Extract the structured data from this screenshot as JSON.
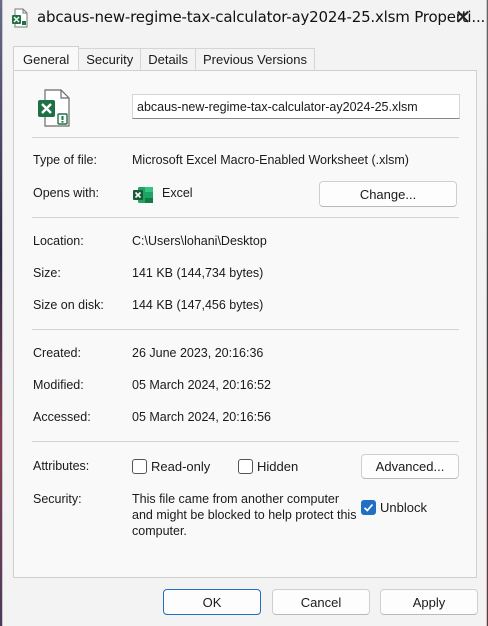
{
  "window": {
    "title": "abcaus-new-regime-tax-calculator-ay2024-25.xlsm Properti...",
    "close_label": "✕"
  },
  "tabs": [
    {
      "label": "General"
    },
    {
      "label": "Security"
    },
    {
      "label": "Details"
    },
    {
      "label": "Previous Versions"
    }
  ],
  "file": {
    "name": "abcaus-new-regime-tax-calculator-ay2024-25.xlsm",
    "icon": "excel-file-icon"
  },
  "type_section": {
    "type_label": "Type of file:",
    "type_value": "Microsoft Excel Macro-Enabled Worksheet (.xlsm)",
    "opens_label": "Opens with:",
    "opens_value": "Excel",
    "change_button": "Change..."
  },
  "location_section": {
    "location_label": "Location:",
    "location_value": "C:\\Users\\lohani\\Desktop",
    "size_label": "Size:",
    "size_value": "141 KB (144,734 bytes)",
    "size_on_disk_label": "Size on disk:",
    "size_on_disk_value": "144 KB (147,456 bytes)"
  },
  "dates_section": {
    "created_label": "Created:",
    "created_value": "26 June 2023, 20:16:36",
    "modified_label": "Modified:",
    "modified_value": "05 March 2024, 20:16:52",
    "accessed_label": "Accessed:",
    "accessed_value": "05 March 2024, 20:16:56"
  },
  "attributes": {
    "label": "Attributes:",
    "readonly_label": "Read-only",
    "readonly_checked": false,
    "hidden_label": "Hidden",
    "hidden_checked": false,
    "advanced_button": "Advanced..."
  },
  "security": {
    "label": "Security:",
    "message": "This file came from another computer and might be blocked to help protect this computer.",
    "unblock_label": "Unblock",
    "unblock_checked": true
  },
  "footer": {
    "ok": "OK",
    "cancel": "Cancel",
    "apply": "Apply"
  },
  "colors": {
    "accent": "#1f6fc5",
    "excel_green": "#1e7145"
  }
}
